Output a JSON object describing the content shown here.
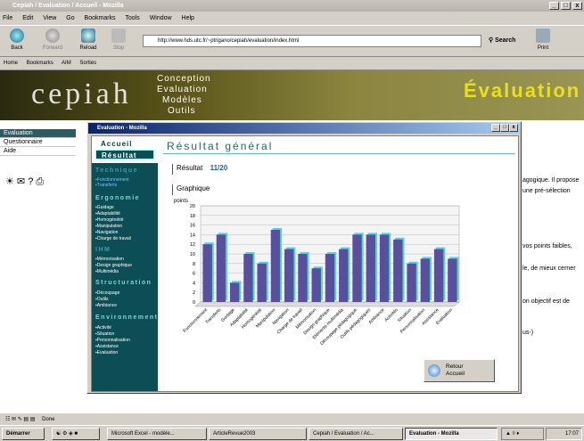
{
  "browser": {
    "title": "Cepiah / Evaluation / Accueil - Mozilla",
    "menu": [
      "File",
      "Edit",
      "View",
      "Go",
      "Bookmarks",
      "Tools",
      "Window",
      "Help"
    ],
    "nav": {
      "back": "Back",
      "forward": "Forward",
      "reload": "Reload",
      "stop": "Stop",
      "search": "Search",
      "print": "Print"
    },
    "url": "http://www.hds.utc.fr/~ptrigano/cepiah/evaluation/index.html",
    "bookmarks": [
      "Home",
      "Bookmarks",
      "AIM",
      "Sorties"
    ],
    "status": "Done"
  },
  "page": {
    "logo": "cepiah",
    "menu": [
      "Conception",
      "Evaluation",
      "Modèles",
      "Outils"
    ],
    "heading": "Évaluation",
    "sidebar": [
      "Evaluation",
      "Questionnaire",
      "Aide"
    ],
    "side_icons": "☀ ✉ ? ⎙",
    "fragments": [
      "agogique. Il propose",
      "une pré-sélection",
      "vos points faibles,",
      "le, de mieux cerner",
      "on objectif est de",
      "us-)"
    ]
  },
  "dialog": {
    "title": "Evaluation - Mozilla",
    "tabs": [
      "Accueil",
      "Résultat"
    ],
    "sections": [
      {
        "name": "Technique",
        "links": [
          "Fonctionnement",
          "Transferts"
        ]
      },
      {
        "name": "Ergonomie",
        "links": [
          "Guidage",
          "Adaptabilité",
          "Homogénéité",
          "Manipulation",
          "Navigation",
          "Charge de travail"
        ]
      },
      {
        "name": "IHM",
        "links": [
          "Mémorisation",
          "Design graphique",
          "Multimédia"
        ]
      },
      {
        "name": "Structuration",
        "links": [
          "Découpage",
          "Outils",
          "Ambiance"
        ]
      },
      {
        "name": "Environnement",
        "links": [
          "Activité",
          "Situation",
          "Personnalisation",
          "Assistance",
          "Evaluation"
        ]
      }
    ],
    "result_title": "Résultat général",
    "result_label": "Résultat",
    "result_value": "11/20",
    "graph_label": "Graphique",
    "retour": [
      "Retour",
      "Accueil"
    ]
  },
  "chart_data": {
    "type": "bar",
    "ylabel": "points",
    "ylim": [
      0,
      20
    ],
    "yticks": [
      0,
      2,
      4,
      6,
      8,
      10,
      12,
      14,
      16,
      18,
      20
    ],
    "categories": [
      "Fonctionnement",
      "Transferts",
      "Guidage",
      "Adaptabilité",
      "Homogénéité",
      "Manipulation",
      "Navigation",
      "Charge de travail",
      "Mémorisation",
      "Design graphique",
      "Eléments multimédia",
      "Découpage pédagogique",
      "Outils pédagogiques",
      "Ambiance",
      "Activités",
      "Situation",
      "Personnalisation",
      "Assistance",
      "Evaluation"
    ],
    "values": [
      12,
      14,
      4,
      10,
      8,
      15,
      11,
      10,
      7,
      10,
      11,
      14,
      14,
      14,
      13,
      8,
      9,
      11,
      9
    ],
    "bar_color": "#5a4f9a",
    "shadow_color": "#4fd4e4"
  },
  "taskbar": {
    "start": "Démarrer",
    "items": [
      "Microsoft Excel - modèle...",
      "ArticleRevue2003",
      "Cepiah / Evaluation / Ac...",
      "Evaluation - Mozilla"
    ],
    "clock": "17:07"
  }
}
